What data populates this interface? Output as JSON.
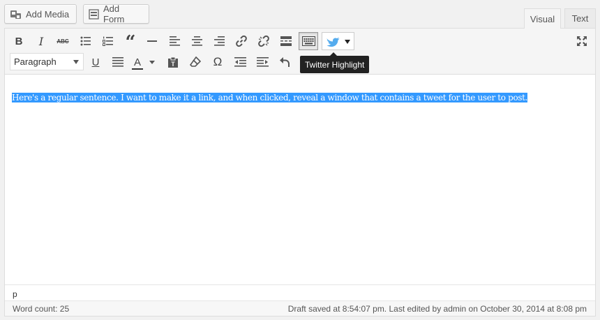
{
  "media_buttons": {
    "add_media": "Add Media",
    "add_form": "Add Form"
  },
  "editor_tabs": [
    {
      "label": "Visual",
      "active": true
    },
    {
      "label": "Text",
      "active": false
    }
  ],
  "toolbar": {
    "format_select": "Paragraph",
    "row1_icons": [
      "bold-icon",
      "italic-icon",
      "strikethrough-icon",
      "bullet-list-icon",
      "numbered-list-icon",
      "blockquote-icon",
      "horizontal-line-icon",
      "align-left-icon",
      "align-center-icon",
      "align-right-icon",
      "link-icon",
      "unlink-icon",
      "read-more-icon",
      "toolbar-toggle-icon",
      "twitter-highlight-icon",
      "fullscreen-icon"
    ],
    "row2_icons": [
      "underline-icon",
      "justify-icon",
      "text-color-icon",
      "paste-as-text-icon",
      "clear-formatting-icon",
      "special-character-icon",
      "outdent-icon",
      "indent-icon",
      "undo-icon"
    ],
    "bold_glyph": "B",
    "italic_glyph": "I",
    "strike_glyph": "ABC",
    "underline_glyph": "U",
    "text_color_glyph": "A",
    "omega_glyph": "Ω",
    "quote_glyph": "“",
    "tooltip": "Twitter Highlight"
  },
  "content": {
    "text": "Here's a regular sentence. I want to make it a link, and when clicked, reveal a window that contains a tweet for the user to post."
  },
  "path": "p",
  "status": {
    "word_count": "Word count: 25",
    "draft_saved": "Draft saved at 8:54:07 pm. Last edited by admin on October 30, 2014 at 8:08 pm"
  },
  "colors": {
    "selection": "#3399ff",
    "twitter_blue": "#55acee",
    "tooltip_bg": "#222222"
  }
}
